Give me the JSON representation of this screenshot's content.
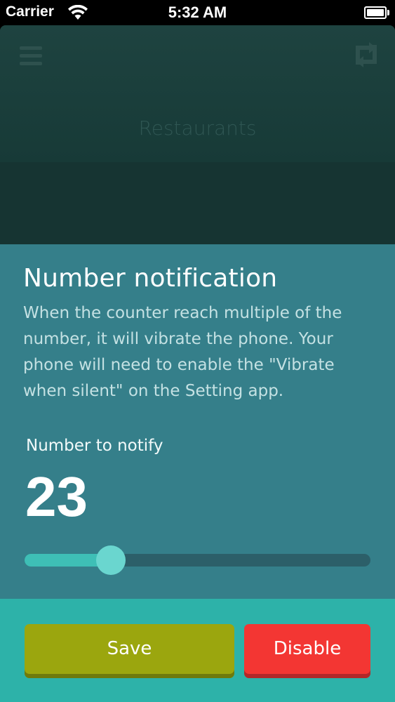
{
  "status_bar": {
    "carrier": "Carrier",
    "time": "5:32 AM",
    "battery_level": 1.0
  },
  "app": {
    "title": "Restaurants",
    "menu_icon": "hamburger-menu-icon",
    "repeat_icon": "repeat-icon"
  },
  "panel": {
    "title": "Number notification",
    "description": "When the counter reach multiple of the number, it will vibrate the phone. Your phone will need to enable the \"Vibrate when silent\" on the Setting app.",
    "label": "Number to notify",
    "value": "23",
    "slider_fraction": 0.25
  },
  "buttons": {
    "save": "Save",
    "disable": "Disable"
  },
  "colors": {
    "panel": "#357f8a",
    "footer": "#2db2a9",
    "save": "#9ba60e",
    "disable": "#f33633",
    "slider_fill": "#3ebfb6",
    "slider_thumb": "#6ad6cf"
  }
}
